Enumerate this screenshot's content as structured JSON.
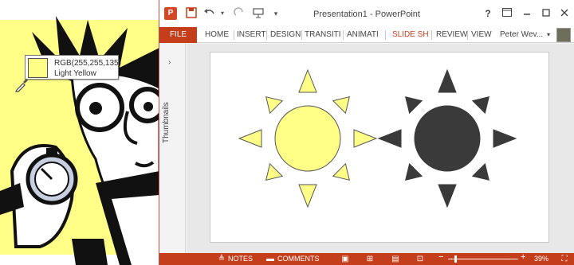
{
  "tooltip": {
    "rgb": "RGB(255,255,135)",
    "name": "Light Yellow",
    "swatch_color": "#ffff87"
  },
  "titlebar": {
    "app_icon": "P",
    "title": "Presentation1 - PowerPoint",
    "help": "?"
  },
  "ribbon": {
    "file": "FILE",
    "tabs": [
      "HOME",
      "INSERT",
      "DESIGN",
      "TRANSITI",
      "ANIMATI",
      "SLIDE SH",
      "REVIEW",
      "VIEW"
    ],
    "active_tab": "SLIDE SH",
    "user": "Peter Wev...",
    "accent": "#c43e1c"
  },
  "thumbnails": {
    "label": "Thumbnails"
  },
  "slide": {
    "shapes": [
      {
        "name": "sun",
        "fill": "#ffff87"
      },
      {
        "name": "sun",
        "fill": "#3a3a3a"
      }
    ]
  },
  "statusbar": {
    "notes": "NOTES",
    "comments": "COMMENTS",
    "zoom_minus": "−",
    "zoom_plus": "+",
    "zoom": "39%"
  }
}
